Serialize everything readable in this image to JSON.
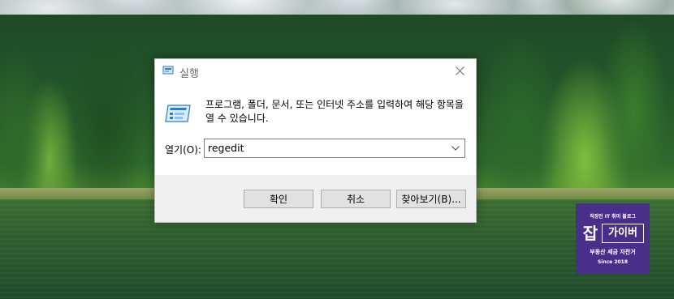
{
  "dialog": {
    "title": "실행",
    "close_icon": "close-icon",
    "description": "프로그램, 폴더, 문서, 또는 인터넷 주소를 입력하여 해당 항목을 열 수 있습니다.",
    "open_label": "열기(O):",
    "input_value": "regedit",
    "dropdown_icon": "chevron-down-icon",
    "buttons": {
      "ok": "확인",
      "cancel": "취소",
      "browse": "찾아보기(B)..."
    }
  },
  "badge": {
    "top": "직장인 IT 취미 블로그",
    "char": "잡",
    "word": "가이버",
    "sub": "부동산 세금 자전거",
    "since": "Since 2018",
    "color": "#4a2f8a"
  }
}
